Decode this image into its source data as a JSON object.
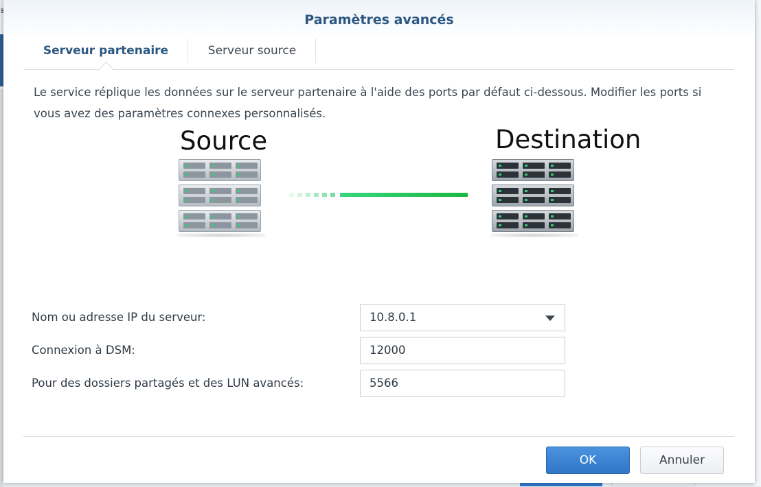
{
  "background": {
    "left_icon_glyph": "≡"
  },
  "dialog": {
    "title": "Paramètres avancés",
    "tabs": [
      {
        "label": "Serveur partenaire",
        "active": true
      },
      {
        "label": "Serveur source",
        "active": false
      }
    ],
    "description": "Le service réplique les données sur le serveur partenaire à l'aide des ports par défaut ci-dessous. Modifier les ports si vous avez des paramètres connexes personnalisés.",
    "diagram": {
      "source_label": "Source",
      "destination_label": "Destination",
      "source_icon": "server-rack-icon",
      "destination_icon": "server-rack-icon",
      "connection_color": "#1bb83f"
    },
    "form": {
      "server_label": "Nom ou adresse IP du serveur:",
      "server_value": "10.8.0.1",
      "dsm_label": "Connexion à DSM:",
      "dsm_value": "12000",
      "shared_label": "Pour des dossiers partagés et des LUN avancés:",
      "shared_value": "5566"
    },
    "buttons": {
      "ok": "OK",
      "cancel": "Annuler"
    }
  },
  "colors": {
    "title": "#2b5782",
    "primary_button": "#2f77c7"
  }
}
